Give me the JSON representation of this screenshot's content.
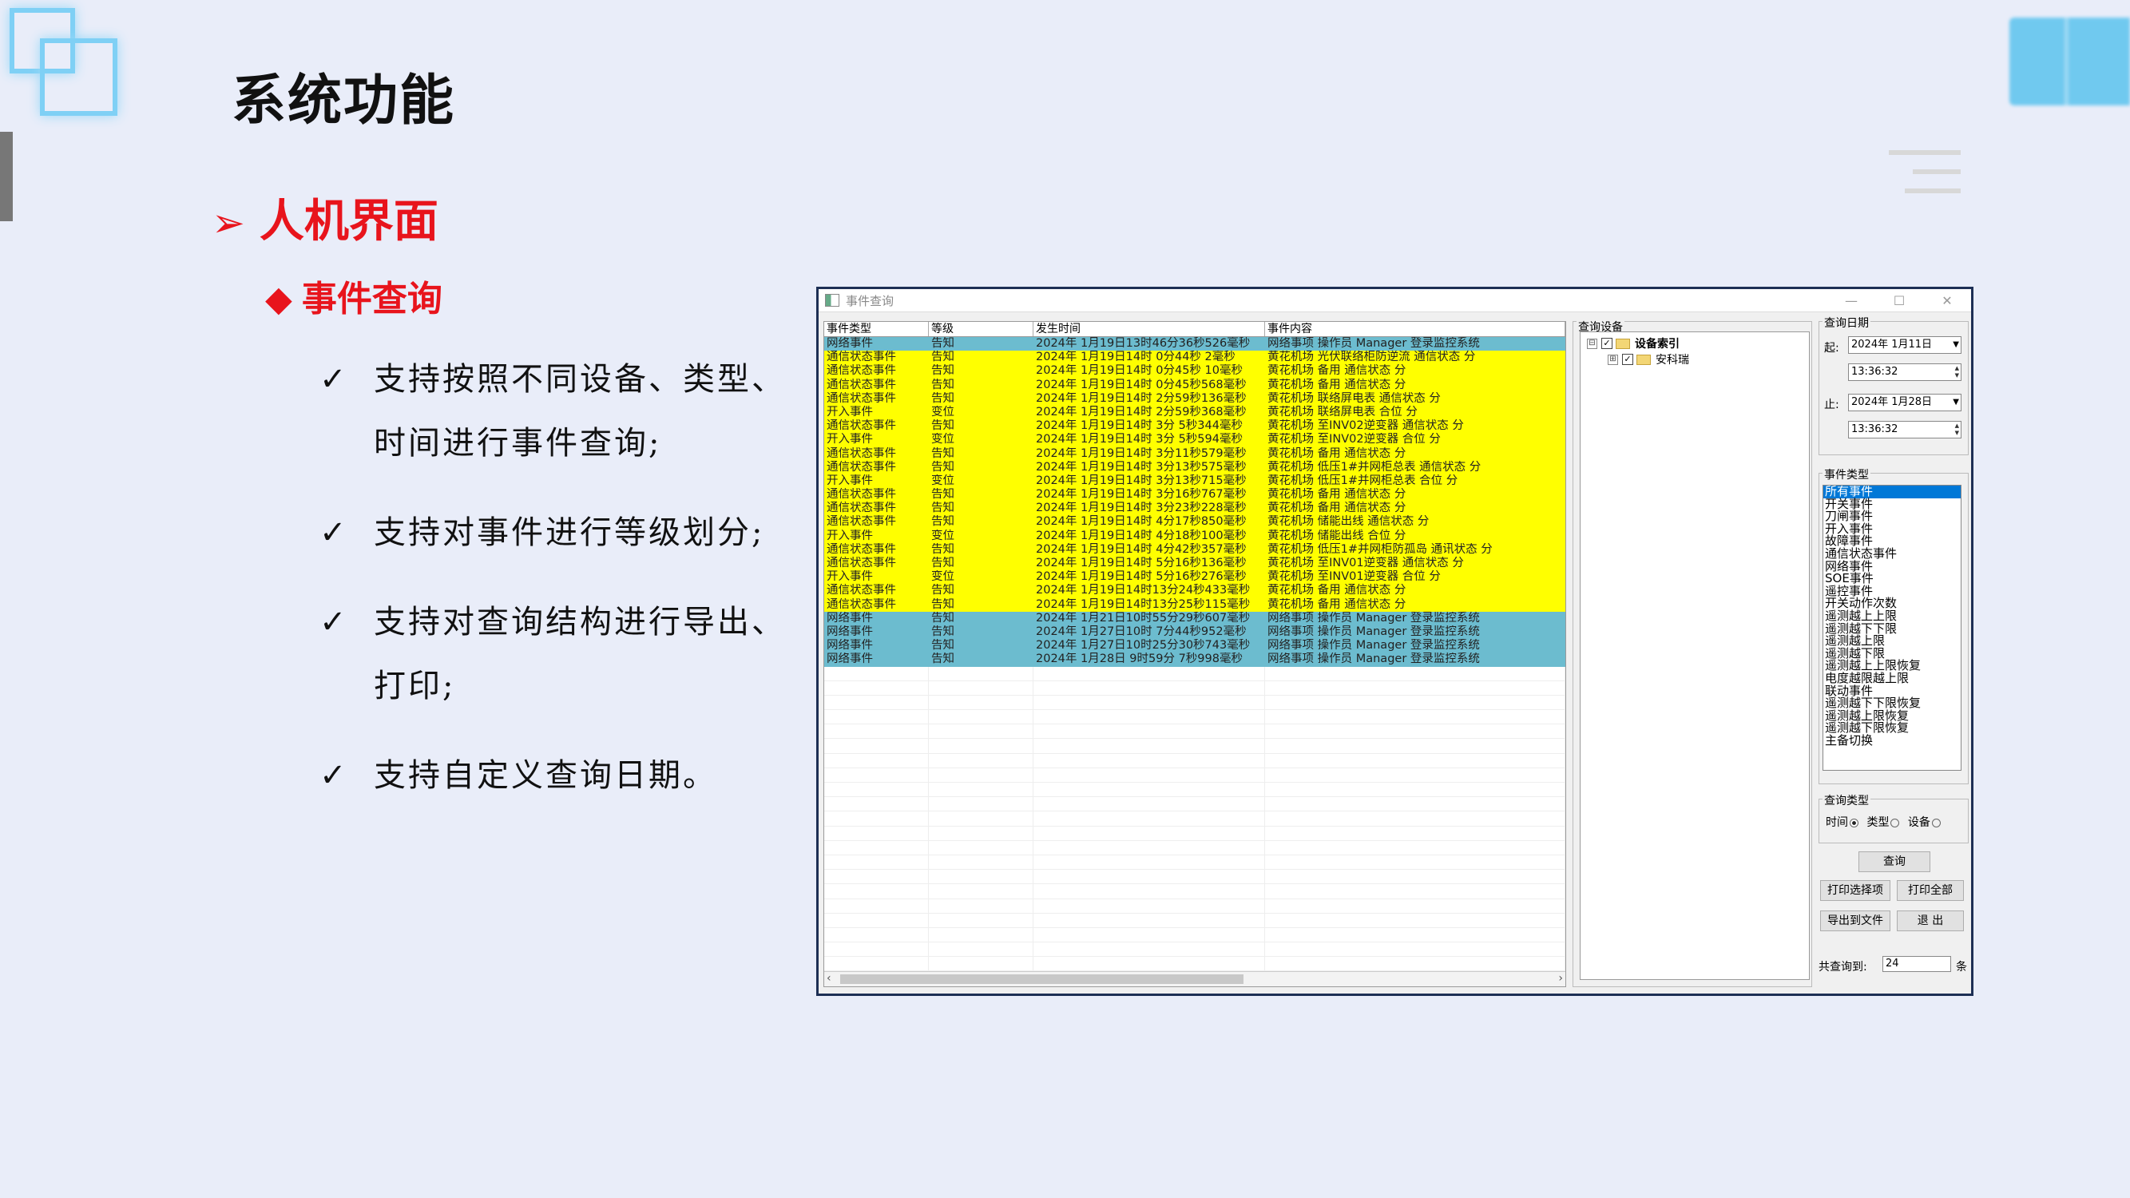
{
  "slide": {
    "title": "系统功能",
    "section": "人机界面",
    "subsection": "事件查询",
    "bullets": [
      "支持按照不同设备、类型、时间进行事件查询;",
      "支持对事件进行等级划分;",
      "支持对查询结构进行导出、打印;",
      "支持自定义查询日期。"
    ]
  },
  "window": {
    "title": "事件查询",
    "grid": {
      "columns": [
        "事件类型",
        "等级",
        "发生时间",
        "事件内容"
      ],
      "rows": [
        {
          "type": "网络事件",
          "level": "告知",
          "time": "2024年 1月19日13时46分36秒526毫秒",
          "content": "网络事项 操作员 Manager 登录监控系统",
          "color": "blue"
        },
        {
          "type": "通信状态事件",
          "level": "告知",
          "time": "2024年 1月19日14时 0分44秒  2毫秒",
          "content": "黄花机场 光伏联络柜防逆流 通信状态 分",
          "color": "yellow"
        },
        {
          "type": "通信状态事件",
          "level": "告知",
          "time": "2024年 1月19日14时 0分45秒 10毫秒",
          "content": "黄花机场 备用 通信状态 分",
          "color": "yellow"
        },
        {
          "type": "通信状态事件",
          "level": "告知",
          "time": "2024年 1月19日14时 0分45秒568毫秒",
          "content": "黄花机场 备用 通信状态 分",
          "color": "yellow"
        },
        {
          "type": "通信状态事件",
          "level": "告知",
          "time": "2024年 1月19日14时 2分59秒136毫秒",
          "content": "黄花机场 联络屏电表 通信状态 分",
          "color": "yellow"
        },
        {
          "type": "开入事件",
          "level": "变位",
          "time": "2024年 1月19日14时 2分59秒368毫秒",
          "content": "黄花机场 联络屏电表 合位 分",
          "color": "yellow"
        },
        {
          "type": "通信状态事件",
          "level": "告知",
          "time": "2024年 1月19日14时 3分 5秒344毫秒",
          "content": "黄花机场 至INV02逆变器 通信状态 分",
          "color": "yellow"
        },
        {
          "type": "开入事件",
          "level": "变位",
          "time": "2024年 1月19日14时 3分 5秒594毫秒",
          "content": "黄花机场 至INV02逆变器 合位 分",
          "color": "yellow"
        },
        {
          "type": "通信状态事件",
          "level": "告知",
          "time": "2024年 1月19日14时 3分11秒579毫秒",
          "content": "黄花机场 备用 通信状态 分",
          "color": "yellow"
        },
        {
          "type": "通信状态事件",
          "level": "告知",
          "time": "2024年 1月19日14时 3分13秒575毫秒",
          "content": "黄花机场 低压1#并网柜总表 通信状态 分",
          "color": "yellow"
        },
        {
          "type": "开入事件",
          "level": "变位",
          "time": "2024年 1月19日14时 3分13秒715毫秒",
          "content": "黄花机场 低压1#并网柜总表 合位 分",
          "color": "yellow"
        },
        {
          "type": "通信状态事件",
          "level": "告知",
          "time": "2024年 1月19日14时 3分16秒767毫秒",
          "content": "黄花机场 备用 通信状态 分",
          "color": "yellow"
        },
        {
          "type": "通信状态事件",
          "level": "告知",
          "time": "2024年 1月19日14时 3分23秒228毫秒",
          "content": "黄花机场 备用 通信状态 分",
          "color": "yellow"
        },
        {
          "type": "通信状态事件",
          "level": "告知",
          "time": "2024年 1月19日14时 4分17秒850毫秒",
          "content": "黄花机场 储能出线 通信状态 分",
          "color": "yellow"
        },
        {
          "type": "开入事件",
          "level": "变位",
          "time": "2024年 1月19日14时 4分18秒100毫秒",
          "content": "黄花机场 储能出线 合位 分",
          "color": "yellow"
        },
        {
          "type": "通信状态事件",
          "level": "告知",
          "time": "2024年 1月19日14时 4分42秒357毫秒",
          "content": "黄花机场 低压1#并网柜防孤岛 通讯状态 分",
          "color": "yellow"
        },
        {
          "type": "通信状态事件",
          "level": "告知",
          "time": "2024年 1月19日14时 5分16秒136毫秒",
          "content": "黄花机场 至INV01逆变器 通信状态 分",
          "color": "yellow"
        },
        {
          "type": "开入事件",
          "level": "变位",
          "time": "2024年 1月19日14时 5分16秒276毫秒",
          "content": "黄花机场 至INV01逆变器 合位 分",
          "color": "yellow"
        },
        {
          "type": "通信状态事件",
          "level": "告知",
          "time": "2024年 1月19日14时13分24秒433毫秒",
          "content": "黄花机场 备用 通信状态 分",
          "color": "yellow"
        },
        {
          "type": "通信状态事件",
          "level": "告知",
          "time": "2024年 1月19日14时13分25秒115毫秒",
          "content": "黄花机场 备用 通信状态 分",
          "color": "yellow"
        },
        {
          "type": "网络事件",
          "level": "告知",
          "time": "2024年 1月21日10时55分29秒607毫秒",
          "content": "网络事项 操作员 Manager 登录监控系统",
          "color": "blue"
        },
        {
          "type": "网络事件",
          "level": "告知",
          "time": "2024年 1月27日10时 7分44秒952毫秒",
          "content": "网络事项 操作员 Manager 登录监控系统",
          "color": "blue"
        },
        {
          "type": "网络事件",
          "level": "告知",
          "time": "2024年 1月27日10时25分30秒743毫秒",
          "content": "网络事项 操作员 Manager 登录监控系统",
          "color": "blue"
        },
        {
          "type": "网络事件",
          "level": "告知",
          "time": "2024年 1月28日 9时59分 7秒998毫秒",
          "content": "网络事项 操作员 Manager 登录监控系统",
          "color": "blue"
        }
      ]
    },
    "device_panel": {
      "label": "查询设备",
      "tree": [
        {
          "label": "设备索引",
          "expander": "⊟",
          "checked": "✓"
        },
        {
          "label": "安科瑞",
          "expander": "⊞",
          "checked": "✓"
        }
      ]
    },
    "date_panel": {
      "label": "查询日期",
      "start_label": "起:",
      "start_date": "2024年 1月11日",
      "start_time": "13:36:32",
      "end_label": "止:",
      "end_date": "2024年 1月28日",
      "end_time": "13:36:32"
    },
    "event_type_panel": {
      "label": "事件类型",
      "items": [
        "所有事件",
        "开关事件",
        "刀闸事件",
        "开入事件",
        "故障事件",
        "通信状态事件",
        "网络事件",
        "SOE事件",
        "遥控事件",
        "开关动作次数",
        "遥测越上上限",
        "遥测越下下限",
        "遥测越上限",
        "遥测越下限",
        "遥测越上上限恢复",
        "电度越限越上限",
        "联动事件",
        "遥测越下下限恢复",
        "遥测越上限恢复",
        "遥测越下限恢复",
        "主备切换"
      ]
    },
    "query_type_panel": {
      "label": "查询类型",
      "options": [
        "时间",
        "类型",
        "设备"
      ],
      "selected": "时间"
    },
    "buttons": {
      "query": "查询",
      "print_selected": "打印选择项",
      "print_all": "打印全部",
      "export": "导出到文件",
      "exit": "退 出"
    },
    "count": {
      "label": "共查询到:",
      "value": "24",
      "unit": "条"
    }
  },
  "colors": {
    "accent_red": "#e8141c",
    "row_yellow": "#ffff00",
    "row_blue": "#6cbccf",
    "window_border": "#1d2f55"
  }
}
